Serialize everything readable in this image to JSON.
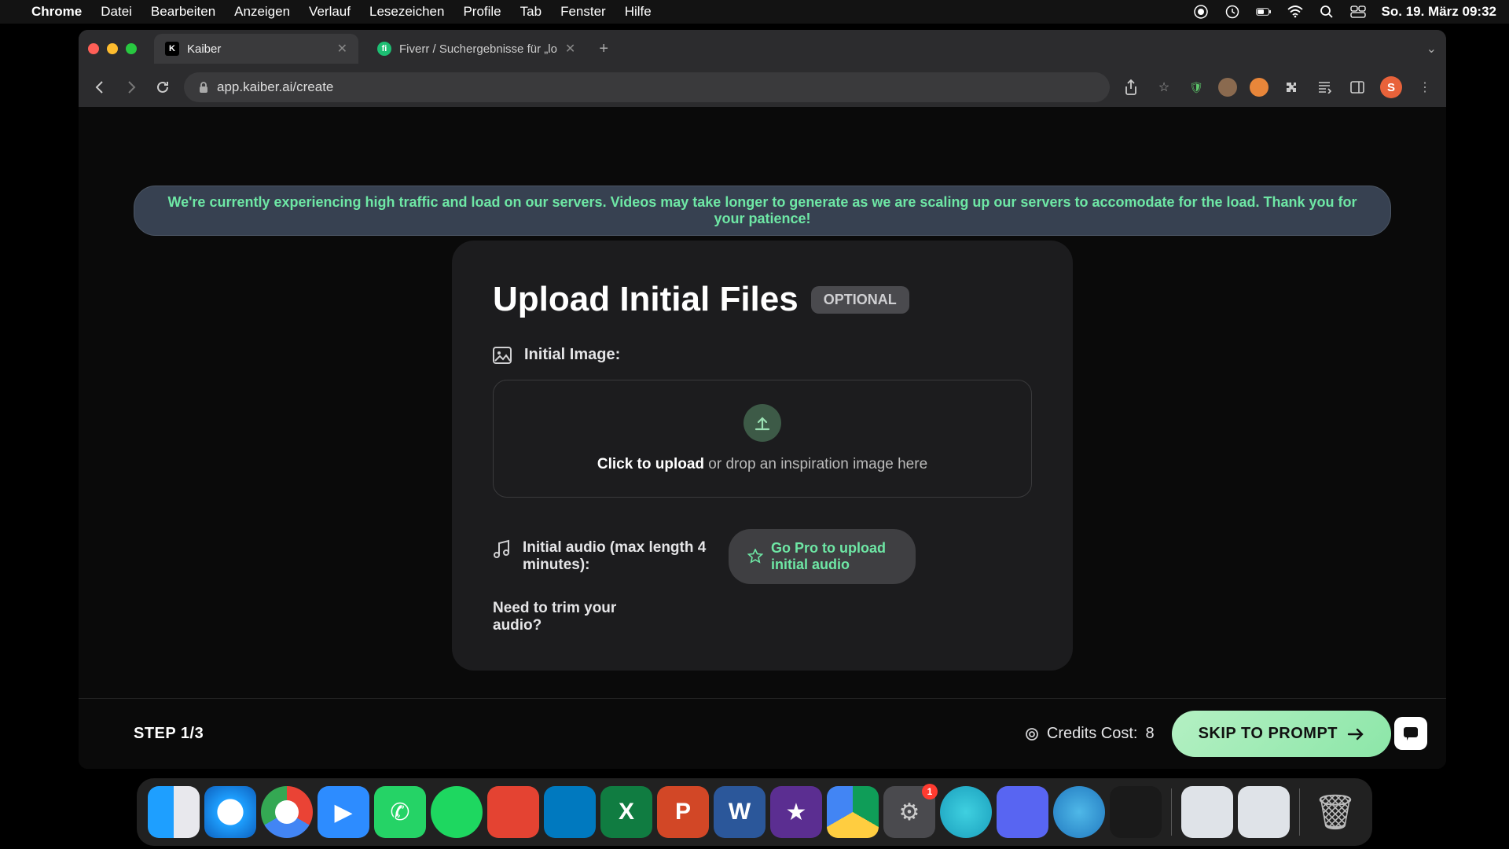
{
  "menubar": {
    "app": "Chrome",
    "items": [
      "Datei",
      "Bearbeiten",
      "Anzeigen",
      "Verlauf",
      "Lesezeichen",
      "Profile",
      "Tab",
      "Fenster",
      "Hilfe"
    ],
    "datetime": "So. 19. März  09:32"
  },
  "tabs": [
    {
      "title": "Kaiber",
      "fav": "K",
      "favbg": "#000",
      "favcolor": "#fff",
      "active": true
    },
    {
      "title": "Fiverr / Suchergebnisse für „lo",
      "fav": "fi",
      "favbg": "#1dbf73",
      "favcolor": "#fff",
      "active": false
    }
  ],
  "url": "app.kaiber.ai/create",
  "avatar_initial": "S",
  "alert": "We're currently experiencing high traffic and load on our servers. Videos may take longer to generate as we are scaling up our servers to accomodate for the load. Thank you for your patience!",
  "card": {
    "title": "Upload Initial Files",
    "badge": "OPTIONAL",
    "image_label": "Initial Image:",
    "upload_bold": "Click to upload",
    "upload_rest": " or drop an inspiration image here",
    "audio_label": "Initial audio (max length 4 minutes):",
    "gopro": "Go Pro to upload initial audio",
    "trim": "Need to trim your audio?"
  },
  "footer": {
    "step": "STEP 1/3",
    "credits_label": "Credits Cost: ",
    "credits_value": "8",
    "skip": "SKIP TO PROMPT"
  },
  "dock": [
    {
      "name": "finder",
      "bg": "linear-gradient(135deg,#1e9fff,#0a7fe0)"
    },
    {
      "name": "safari",
      "bg": "linear-gradient(135deg,#e8e8ed,#c9c9d0)"
    },
    {
      "name": "chrome",
      "bg": "#fff"
    },
    {
      "name": "zoom",
      "bg": "#2d8cff"
    },
    {
      "name": "whatsapp",
      "bg": "#25d366"
    },
    {
      "name": "spotify",
      "bg": "#1ed760"
    },
    {
      "name": "todoist",
      "bg": "#e44332"
    },
    {
      "name": "trello",
      "bg": "#0079bf"
    },
    {
      "name": "excel",
      "bg": "#107c41"
    },
    {
      "name": "powerpoint",
      "bg": "#d24726"
    },
    {
      "name": "word",
      "bg": "#2b579a"
    },
    {
      "name": "imovie",
      "bg": "#5b2e91"
    },
    {
      "name": "drive",
      "bg": "#fff"
    },
    {
      "name": "settings",
      "bg": "#4a4a4e",
      "badge": "1"
    },
    {
      "name": "siri",
      "bg": "radial-gradient(circle,#3fd0e0,#1a9fbd)"
    },
    {
      "name": "discord",
      "bg": "#5865f2"
    },
    {
      "name": "quicktime",
      "bg": "radial-gradient(circle,#4fb8e8,#2179c0)"
    },
    {
      "name": "audio-app",
      "bg": "#1a1a1a"
    }
  ]
}
